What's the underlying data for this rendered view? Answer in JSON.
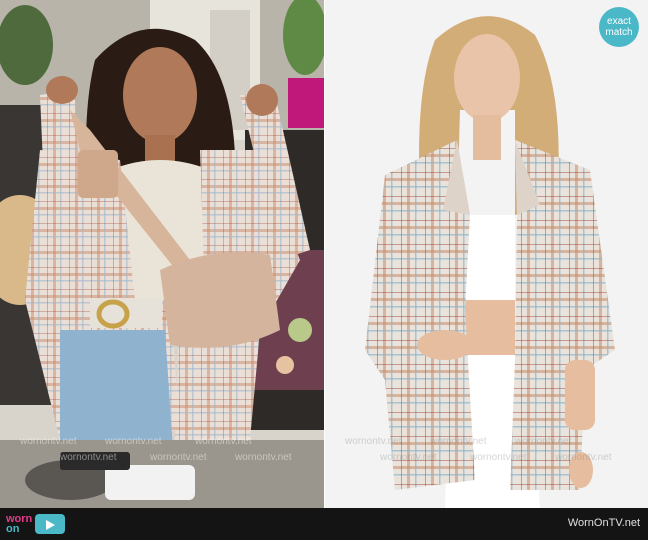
{
  "badge": {
    "line1": "exact",
    "line2": "match"
  },
  "watermark": {
    "text": "wornontv.net"
  },
  "footer": {
    "logo": {
      "word1": "worn",
      "word2": "on",
      "icon": "tv-play-icon"
    },
    "site": "WornOnTV.net"
  },
  "colors": {
    "badge": "#4bb8c7",
    "footer_bg": "#141414",
    "logo_pink": "#e23a8a",
    "logo_teal": "#4bb8c7"
  }
}
